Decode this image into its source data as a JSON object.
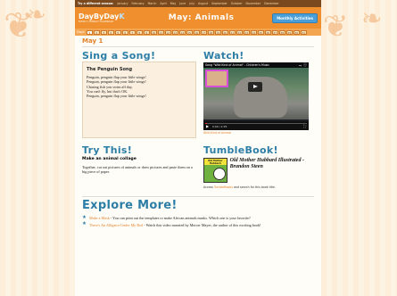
{
  "topnav": {
    "first": "Try a different season:",
    "months": [
      "January",
      "February",
      "March",
      "April",
      "May",
      "June",
      "July",
      "August",
      "September",
      "October",
      "November",
      "December"
    ]
  },
  "header": {
    "logo_main": "DayByDay",
    "logo_k": "K",
    "logo_sub": "FAMILY LITERACY CALENDAR",
    "title": "May: Animals",
    "monthly_button": "Monthly Activities"
  },
  "days": {
    "label": "Days",
    "items": [
      "1",
      "2",
      "3",
      "4",
      "5",
      "6",
      "7",
      "8",
      "9",
      "10",
      "11",
      "12",
      "13",
      "14",
      "15",
      "16",
      "17",
      "18",
      "19",
      "20",
      "21",
      "22",
      "23",
      "24",
      "25",
      "26",
      "27",
      "28",
      "29",
      "30",
      "31"
    ],
    "active_index": 0
  },
  "date_heading": "May 1",
  "sing": {
    "heading": "Sing a Song!",
    "song_title": "The Penguin Song",
    "lines": [
      "Penguin, penguin flap your little wings!",
      "Penguin, penguin flap your little wings!",
      "Chasing fish you swim all day,",
      "You can't fly, but that's OK.",
      "Penguin, penguin flap your little wings!"
    ]
  },
  "watch": {
    "heading": "Watch!",
    "video_title": "Song \"Wild Kind of Animal\" - Children's Music",
    "time": "0:00 / 2:25",
    "progress": 0.02,
    "caption": "Wild Kind of Animal"
  },
  "try": {
    "heading": "Try This!",
    "subtitle": "Make an animal collage",
    "text": "Together, cut out pictures of animals or draw pictures and paste them on a big piece of paper."
  },
  "tumble": {
    "heading": "TumbleBook!",
    "cover_text": "Old Mother Hubbard",
    "book_title": "Old Mother Hubbard Illustrated - Brandon Steen",
    "access_prefix": "Access",
    "access_link": "TumbleBooks",
    "access_suffix": "and search for this book title."
  },
  "explore": {
    "heading": "Explore More!",
    "items": [
      {
        "link": "Make a Mask",
        "text": " - You can print out the templates to make African animals masks. Which one is your favorite?"
      },
      {
        "link": "There's An Alligator Under My Bed",
        "text": " - Watch this video narrated by Mercer Mayer, the author of this exciting book!"
      }
    ]
  }
}
